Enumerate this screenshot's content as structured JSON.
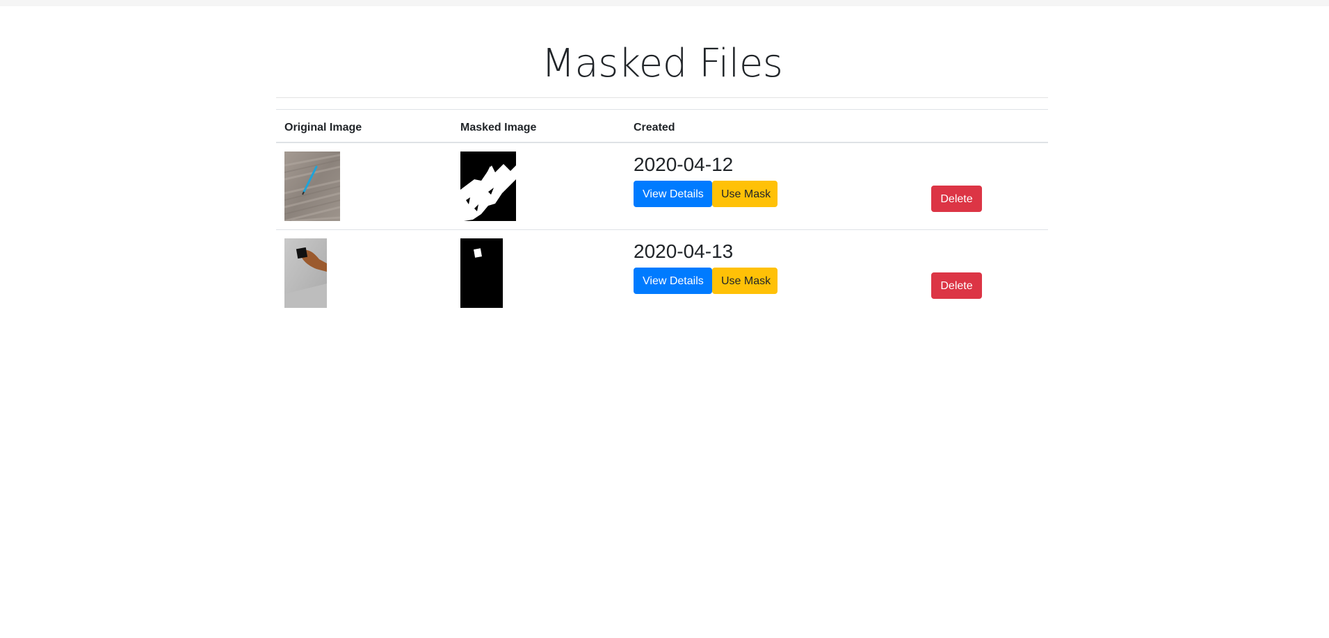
{
  "page": {
    "title": "Masked Files"
  },
  "table": {
    "headers": {
      "original": "Original Image",
      "masked": "Masked Image",
      "created": "Created",
      "actions": ""
    },
    "rows": [
      {
        "created": "2020-04-12",
        "view_label": "View Details",
        "use_label": "Use Mask",
        "delete_label": "Delete"
      },
      {
        "created": "2020-04-13",
        "view_label": "View Details",
        "use_label": "Use Mask",
        "delete_label": "Delete"
      }
    ]
  },
  "colors": {
    "primary": "#007bff",
    "warning": "#ffc107",
    "danger": "#dc3545"
  }
}
